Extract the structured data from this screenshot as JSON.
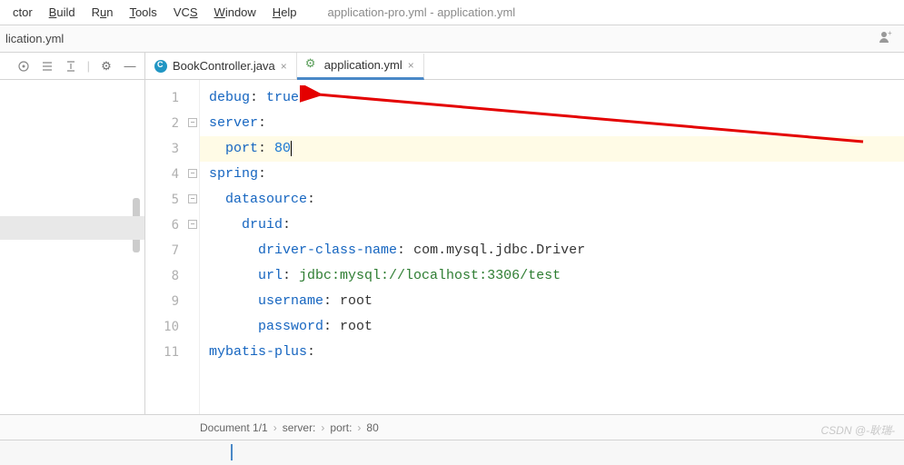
{
  "menubar": {
    "items": [
      {
        "label": "ctor",
        "u": ""
      },
      {
        "label": "Build",
        "u": "B"
      },
      {
        "label": "Run",
        "u": "u"
      },
      {
        "label": "Tools",
        "u": "T"
      },
      {
        "label": "VCS",
        "u": "S"
      },
      {
        "label": "Window",
        "u": "W"
      },
      {
        "label": "Help",
        "u": "H"
      }
    ],
    "title": "application-pro.yml - application.yml"
  },
  "navbar": {
    "crumb": "lication.yml"
  },
  "tabs": [
    {
      "label": "BookController.java",
      "type": "java",
      "active": false
    },
    {
      "label": "application.yml",
      "type": "yml",
      "active": true
    }
  ],
  "code": {
    "lines": [
      {
        "n": 1,
        "segs": [
          {
            "t": "debug",
            "c": "k-key"
          },
          {
            "t": ": ",
            "c": "k-plain"
          },
          {
            "t": "true",
            "c": "k-val"
          }
        ]
      },
      {
        "n": 2,
        "fold": true,
        "segs": [
          {
            "t": "server",
            "c": "k-key"
          },
          {
            "t": ":",
            "c": "k-plain"
          }
        ]
      },
      {
        "n": 3,
        "hl": true,
        "segs": [
          {
            "t": "  port",
            "c": "k-key"
          },
          {
            "t": ": ",
            "c": "k-plain"
          },
          {
            "t": "80",
            "c": "k-num",
            "caret": true
          }
        ]
      },
      {
        "n": 4,
        "fold": true,
        "segs": [
          {
            "t": "spring",
            "c": "k-key"
          },
          {
            "t": ":",
            "c": "k-plain"
          }
        ]
      },
      {
        "n": 5,
        "fold": true,
        "segs": [
          {
            "t": "  datasource",
            "c": "k-key"
          },
          {
            "t": ":",
            "c": "k-plain"
          }
        ]
      },
      {
        "n": 6,
        "fold": true,
        "segs": [
          {
            "t": "    druid",
            "c": "k-key"
          },
          {
            "t": ":",
            "c": "k-plain"
          }
        ]
      },
      {
        "n": 7,
        "segs": [
          {
            "t": "      driver-class-name",
            "c": "k-key"
          },
          {
            "t": ": ",
            "c": "k-plain"
          },
          {
            "t": "com.mysql.jdbc.Driver",
            "c": "k-plain"
          }
        ]
      },
      {
        "n": 8,
        "segs": [
          {
            "t": "      url",
            "c": "k-key"
          },
          {
            "t": ": ",
            "c": "k-plain"
          },
          {
            "t": "jdbc:mysql://localhost:3306/test",
            "c": "k-str"
          }
        ]
      },
      {
        "n": 9,
        "segs": [
          {
            "t": "      username",
            "c": "k-key"
          },
          {
            "t": ": ",
            "c": "k-plain"
          },
          {
            "t": "root",
            "c": "k-plain"
          }
        ]
      },
      {
        "n": 10,
        "segs": [
          {
            "t": "      password",
            "c": "k-key"
          },
          {
            "t": ": ",
            "c": "k-plain"
          },
          {
            "t": "root",
            "c": "k-plain"
          }
        ]
      },
      {
        "n": 11,
        "segs": [
          {
            "t": "mybatis-plus",
            "c": "k-key"
          },
          {
            "t": ":",
            "c": "k-plain"
          }
        ]
      }
    ]
  },
  "breadcrumb": {
    "doc": "Document 1/1",
    "path": [
      "server:",
      "port:",
      "80"
    ]
  },
  "watermark": "CSDN @-耿瑞-"
}
